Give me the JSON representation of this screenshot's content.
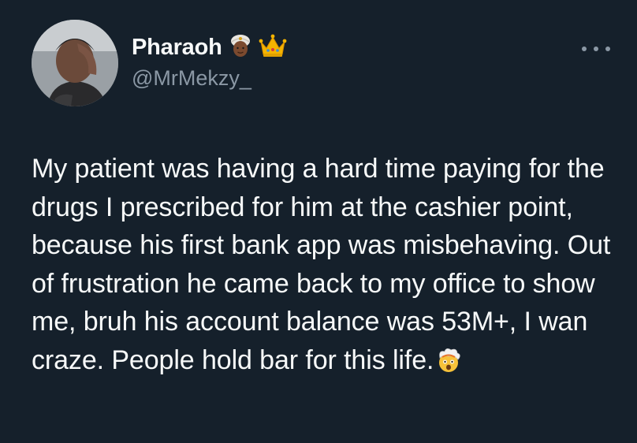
{
  "author": {
    "display_name": "Pharaoh",
    "handle": "@MrMekzy_",
    "name_emojis": [
      "person-with-turban-emoji",
      "crown-emoji"
    ]
  },
  "menu": {
    "more_icon": "more-horizontal-icon"
  },
  "tweet": {
    "text": "My patient was having a hard time paying for the drugs I prescribed for him at the cashier point, because his first bank app was misbehaving. Out of frustration he came back to my office to show me, bruh his account balance was 53M+, I wan craze. People hold bar for this life.",
    "trailing_emoji": "exploding-head-emoji"
  },
  "colors": {
    "background": "#15202b",
    "text_primary": "#f7f9f9",
    "text_secondary": "#8b98a5"
  }
}
